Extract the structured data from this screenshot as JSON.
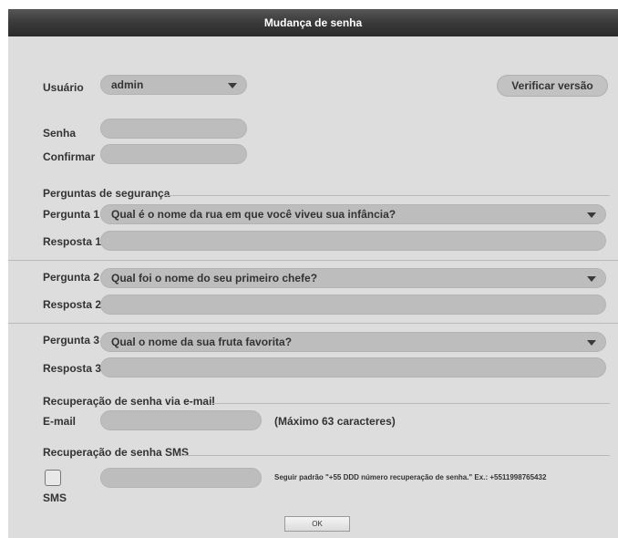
{
  "dialog": {
    "title": "Mudança de senha",
    "user_label": "Usuário",
    "user_value": "admin",
    "verify_button": "Verificar versão",
    "password_label": "Senha",
    "confirm_label": "Confirmar",
    "security_section": "Perguntas de segurança",
    "questions": [
      {
        "label": "Pergunta 1",
        "value": "Qual é o nome da rua em que você viveu sua infância?",
        "answer_label": "Resposta 1"
      },
      {
        "label": "Pergunta 2",
        "value": "Qual foi o nome do seu primeiro chefe?",
        "answer_label": "Resposta 2"
      },
      {
        "label": "Pergunta 3",
        "value": "Qual o nome da sua fruta favorita?",
        "answer_label": "Resposta 3"
      }
    ],
    "email_section": "Recuperação de senha via e-mail",
    "email_label": "E-mail",
    "email_hint": "(Máximo 63 caracteres)",
    "sms_section": "Recuperação de senha SMS",
    "sms_label": "SMS",
    "sms_hint": "Seguir padrão \"+55 DDD número recuperação de senha.\" Ex.: +5511998765432",
    "ok_button": "OK"
  }
}
